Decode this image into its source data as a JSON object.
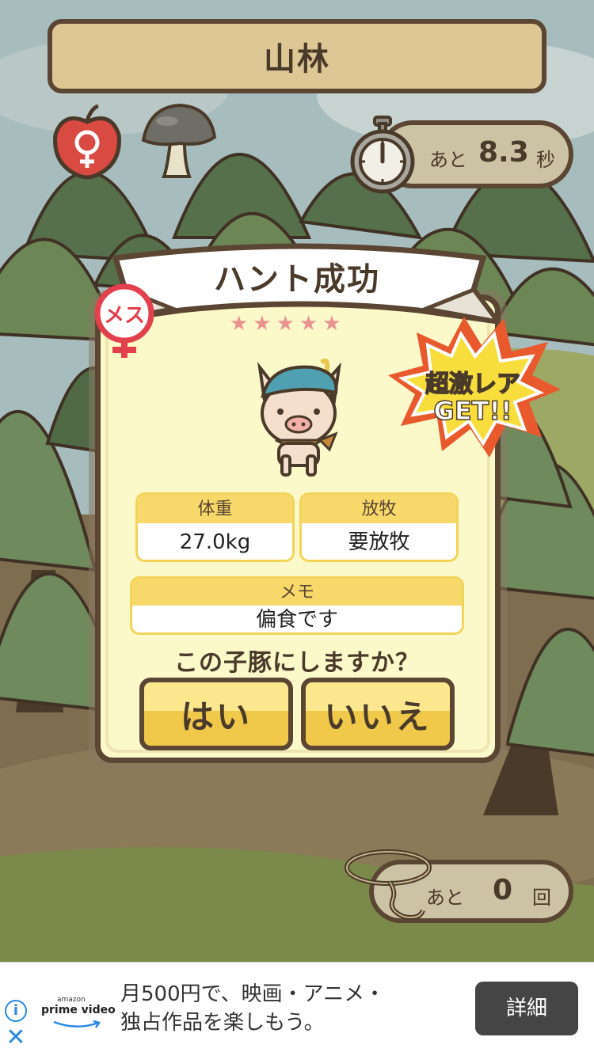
{
  "location": {
    "title": "山林"
  },
  "timer": {
    "prefix": "あと",
    "value": "8.3",
    "unit": "秒"
  },
  "result": {
    "title": "ハント成功",
    "gender_badge": "メス",
    "stars": "★★★★★",
    "rarity_badge": [
      "超激レア",
      "GET!!"
    ],
    "weight": {
      "label": "体重",
      "value": "27.0kg"
    },
    "grazing": {
      "label": "放牧",
      "value": "要放牧"
    },
    "memo": {
      "label": "メモ",
      "value": "偏食です"
    },
    "question": "この子豚にしますか？",
    "yes_label": "はい",
    "no_label": "いいえ"
  },
  "remaining": {
    "prefix": "あと",
    "value": "0",
    "unit": "回"
  },
  "ad": {
    "brand_small": "amazon",
    "brand": "prime video",
    "line1": "月500円で、映画・アニメ・",
    "line2": "独占作品を楽しもう。",
    "button_label": "詳細",
    "info_glyph": "i",
    "close_glyph": "✕"
  },
  "colors": {
    "sky": "#9fb4b5",
    "tree_dark": "#55704a",
    "tree_light": "#7f9a62",
    "card_bg": "#fbf8c9",
    "border": "#5a4632",
    "star": "#e8948f",
    "button": "#f0c84a"
  }
}
